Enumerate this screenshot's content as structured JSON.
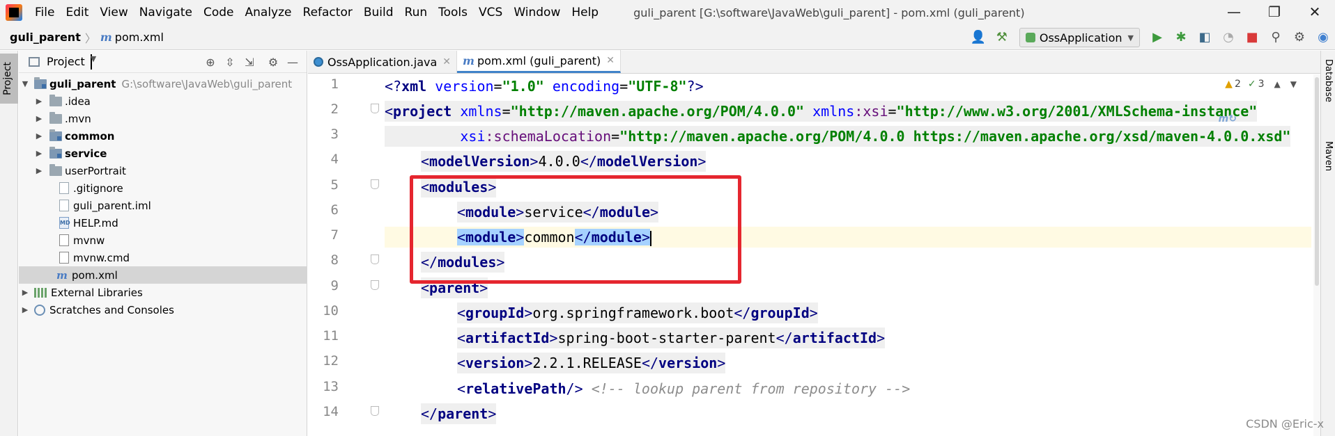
{
  "menubar": {
    "items": [
      "File",
      "Edit",
      "View",
      "Navigate",
      "Code",
      "Analyze",
      "Refactor",
      "Build",
      "Run",
      "Tools",
      "VCS",
      "Window",
      "Help"
    ],
    "window_title": "guli_parent [G:\\software\\JavaWeb\\guli_parent] - pom.xml (guli_parent)",
    "minimize": "—",
    "restore": "❐",
    "close": "✕"
  },
  "navbar": {
    "project": "guli_parent",
    "file": "pom.xml",
    "run_config": "OssApplication"
  },
  "left_stripe": {
    "tab": "Project"
  },
  "project_panel": {
    "title": "Project",
    "root": {
      "name": "guli_parent",
      "path": "G:\\software\\JavaWeb\\guli_parent"
    },
    "items": [
      {
        "name": ".idea",
        "type": "folder"
      },
      {
        "name": ".mvn",
        "type": "folder"
      },
      {
        "name": "common",
        "type": "module"
      },
      {
        "name": "service",
        "type": "module"
      },
      {
        "name": "userPortrait",
        "type": "folder"
      },
      {
        "name": ".gitignore",
        "type": "file"
      },
      {
        "name": "guli_parent.iml",
        "type": "file"
      },
      {
        "name": "HELP.md",
        "type": "md"
      },
      {
        "name": "mvnw",
        "type": "file"
      },
      {
        "name": "mvnw.cmd",
        "type": "file"
      },
      {
        "name": "pom.xml",
        "type": "maven"
      }
    ],
    "external_libraries": "External Libraries",
    "scratches": "Scratches and Consoles"
  },
  "editor": {
    "tabs": [
      {
        "label": "OssApplication.java",
        "active": false
      },
      {
        "label": "pom.xml (guli_parent)",
        "active": true
      }
    ],
    "inspection": {
      "warnings": "2",
      "ok": "3"
    },
    "line_numbers": [
      "1",
      "2",
      "3",
      "4",
      "5",
      "6",
      "7",
      "8",
      "9",
      "10",
      "11",
      "12",
      "13",
      "14"
    ],
    "code": {
      "l1a": "<?",
      "l1b": "xml",
      "l1c": " version",
      "l1d": "=",
      "l1e": "\"1.0\"",
      "l1f": " encoding",
      "l1g": "=",
      "l1h": "\"UTF-8\"",
      "l1i": "?>",
      "l2a": "<",
      "l2b": "project",
      "l2c": " xmlns",
      "l2d": "=",
      "l2e": "\"http://maven.apache.org/POM/4.0.0\"",
      "l2f": " xmlns",
      "l2g": ":xsi",
      "l2h": "=",
      "l2i": "\"http://www.w3.org/2001/XMLSchema-instance\"",
      "l3a": "         xsi",
      "l3b": ":schemaLocation",
      "l3c": "=",
      "l3d": "\"http://maven.apache.org/POM/4.0.0 https://maven.apache.org/xsd/maven-4.0.0.xsd\"",
      "l4": "modelVersion",
      "l4v": "4.0.0",
      "l5": "modules",
      "l6": "module",
      "l6v": "service",
      "l7": "module",
      "l7v": "common",
      "l8": "modules",
      "l9": "parent",
      "l10": "groupId",
      "l10v": "org.springframework.boot",
      "l11": "artifactId",
      "l11v": "spring-boot-starter-parent",
      "l12": "version",
      "l12v": "2.2.1.RELEASE",
      "l13": "relativePath",
      "l13c": "<!-- lookup parent from repository -->",
      "l14": "parent"
    }
  },
  "right_stripe": {
    "database": "Database",
    "maven": "Maven"
  },
  "watermark": "CSDN @Eric-x"
}
